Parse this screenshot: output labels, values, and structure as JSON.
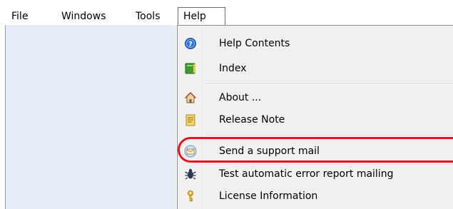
{
  "menubar": {
    "items": [
      "File",
      "Windows",
      "Tools",
      "Help"
    ]
  },
  "help_menu": {
    "items": [
      {
        "label": "Help Contents",
        "icon": "help-icon"
      },
      {
        "label": "Index",
        "icon": "book-icon"
      },
      {
        "label": "About ...",
        "icon": "home-icon"
      },
      {
        "label": "Release Note",
        "icon": "note-icon"
      },
      {
        "label": "Send a support mail",
        "icon": "mail-icon"
      },
      {
        "label": "Test automatic error report mailing",
        "icon": "bug-icon"
      },
      {
        "label": "License Information",
        "icon": "key-icon"
      }
    ]
  },
  "colors": {
    "highlight": "#e8141c",
    "menu_bg": "#f0f0f0"
  }
}
